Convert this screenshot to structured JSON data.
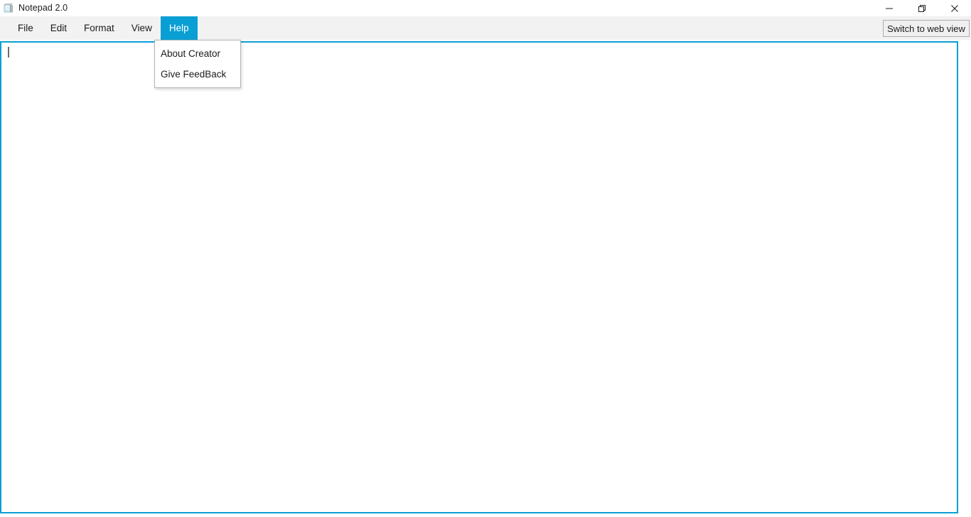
{
  "window": {
    "title": "Notepad 2.0",
    "icon": "notepad-icon",
    "controls": {
      "minimize": "minimize-icon",
      "restore": "restore-icon",
      "close": "close-icon"
    }
  },
  "menubar": {
    "items": [
      {
        "label": "File",
        "active": false
      },
      {
        "label": "Edit",
        "active": false
      },
      {
        "label": "Format",
        "active": false
      },
      {
        "label": "View",
        "active": false
      },
      {
        "label": "Help",
        "active": true
      }
    ],
    "switch_view_label": "Switch to web view"
  },
  "help_menu": {
    "open": true,
    "items": [
      {
        "label": "About Creator"
      },
      {
        "label": "Give FeedBack"
      }
    ]
  },
  "editor": {
    "content": "",
    "placeholder": "",
    "caret_visible": true
  },
  "colors": {
    "accent": "#0a9fd4",
    "menubar_bg": "#f2f2f2",
    "titlebar_bg": "#ffffff",
    "editor_bg": "#ffffff",
    "text": "#1b1b1b",
    "button_bg": "#f0f0f0",
    "button_border": "#adadad",
    "dropdown_border": "#b4b4b4",
    "caret": "#6e6e6e"
  }
}
